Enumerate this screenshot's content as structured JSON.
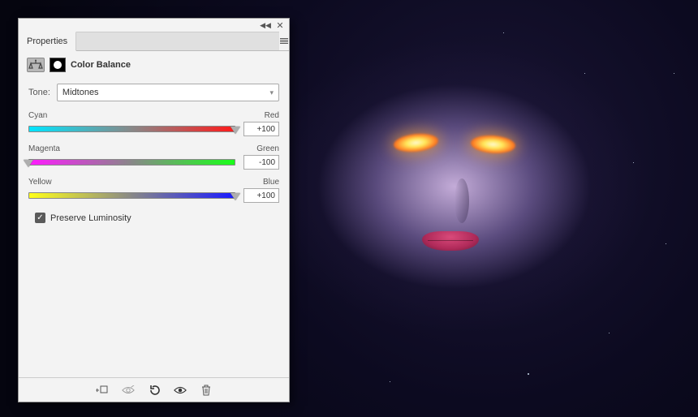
{
  "panel": {
    "tab_label": "Properties",
    "adjustment_title": "Color Balance",
    "tone_label": "Tone:",
    "tone_value": "Midtones",
    "sliders": {
      "cr": {
        "left_label": "Cyan",
        "right_label": "Red",
        "value": "+100",
        "pos_pct": 100
      },
      "mg": {
        "left_label": "Magenta",
        "right_label": "Green",
        "value": "-100",
        "pos_pct": 0
      },
      "yb": {
        "left_label": "Yellow",
        "right_label": "Blue",
        "value": "+100",
        "pos_pct": 100
      }
    },
    "preserve_label": "Preserve Luminosity",
    "preserve_checked": true
  }
}
